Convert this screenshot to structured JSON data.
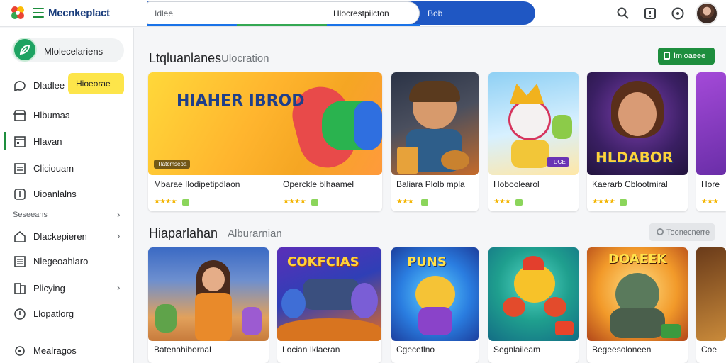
{
  "header": {
    "brand": "Mecnkeplact",
    "search_placeholder": "Idlee",
    "search_mid_text": "Hlocrestpiicton",
    "search_button_label": "Bob"
  },
  "sidebar": {
    "profile_label": "Mlolecelariens",
    "items": [
      {
        "label": "Dladlee",
        "icon": "chat-bubble-icon"
      },
      {
        "label": "Hlbumaa",
        "icon": "store-icon"
      },
      {
        "label": "Hlavan",
        "icon": "window-icon"
      },
      {
        "label": "Cliciouam",
        "icon": "list-icon"
      },
      {
        "label": "Uioanlalns",
        "icon": "square-icon"
      }
    ],
    "chip_label": "Hioeorae",
    "section_title": "Seseeans",
    "section_items": [
      {
        "label": "Dlackepieren",
        "icon": "home-icon"
      },
      {
        "label": "Nlegeoahlaro",
        "icon": "document-icon"
      },
      {
        "label": "Plicying",
        "icon": "bookmark-icon"
      },
      {
        "label": "Llopatlorg",
        "icon": "info-icon"
      },
      {
        "label": "Mealragos",
        "icon": "circle-icon"
      }
    ]
  },
  "sections": [
    {
      "title": "Ltqluanlanes",
      "subtitle": "Ulocration",
      "action_label": "Imloaeee",
      "cards": [
        {
          "title": "Mbarae Ilodipetipdlaon",
          "stars": "★★★★",
          "thumb_text": "HIAHER IBROD",
          "thumb_tag": "Tlatcmseoa"
        },
        {
          "title": "Operckle blhaamel",
          "stars": "★★★★",
          "thumb_text": "",
          "thumb_tag": ""
        },
        {
          "title": "Baliara Plolb mpla",
          "stars": "★★★",
          "thumb_text": "",
          "thumb_tag": ""
        },
        {
          "title": "Hoboolearol",
          "stars": "★★★",
          "thumb_text": "",
          "thumb_tag": "TDCE"
        },
        {
          "title": "Kaerarb Cblootmiral",
          "stars": "★★★★",
          "thumb_text": "HLDABOR",
          "thumb_tag": ""
        },
        {
          "title": "Hore",
          "stars": "★★★",
          "thumb_text": "",
          "thumb_tag": ""
        }
      ]
    },
    {
      "title": "Hiaparlahan",
      "subtitle": "Alburarnian",
      "action_label": "Toonecnerre",
      "cards": [
        {
          "title": "Batenahibornal",
          "stars": "★★",
          "thumb_text": "",
          "thumb_tag": ""
        },
        {
          "title": "Locian Iklaeran",
          "stars": "★★",
          "thumb_text": "COKFCIAS",
          "thumb_tag": ""
        },
        {
          "title": "Cgeceflno",
          "stars": "★★",
          "thumb_text": "PUNS",
          "thumb_tag": ""
        },
        {
          "title": "Segnlaileam",
          "stars": "★★★",
          "thumb_text": "",
          "thumb_tag": ""
        },
        {
          "title": "Begeesoloneen",
          "stars": "★★★",
          "thumb_text": "DOAEEK",
          "thumb_tag": ""
        },
        {
          "title": "Coe",
          "stars": "★★",
          "thumb_text": "",
          "thumb_tag": ""
        }
      ]
    }
  ]
}
